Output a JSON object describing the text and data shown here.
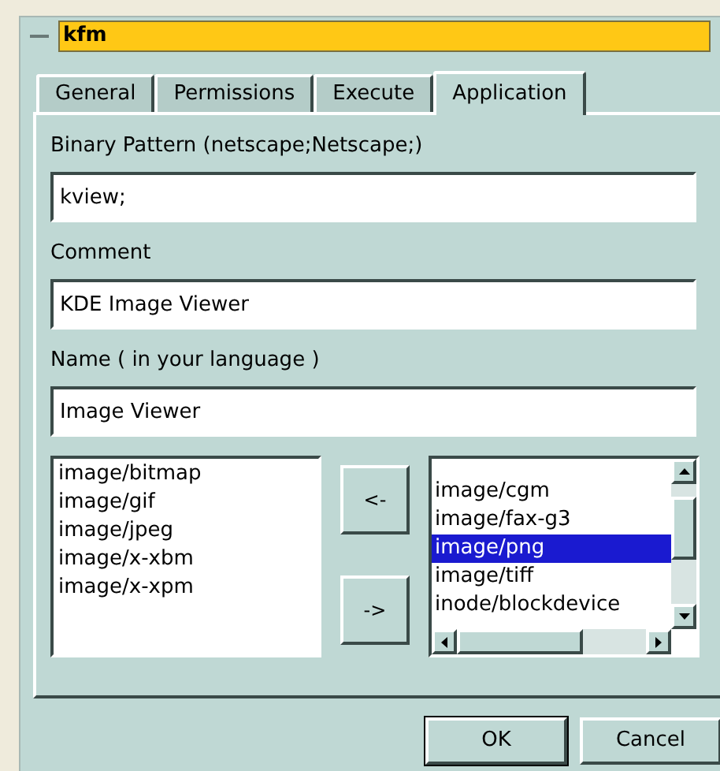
{
  "window": {
    "title": "kfm"
  },
  "tabs": [
    {
      "label": "General",
      "selected": false
    },
    {
      "label": "Permissions",
      "selected": false
    },
    {
      "label": "Execute",
      "selected": false
    },
    {
      "label": "Application",
      "selected": true
    }
  ],
  "fields": [
    {
      "label": "Binary Pattern (netscape;Netscape;)",
      "value": "kview;"
    },
    {
      "label": "Comment",
      "value": "KDE Image Viewer"
    },
    {
      "label": "Name ( in your language )",
      "value": "Image Viewer"
    }
  ],
  "selected_types": [
    {
      "label": "image/bitmap"
    },
    {
      "label": "image/gif"
    },
    {
      "label": "image/jpeg"
    },
    {
      "label": "image/x-xbm"
    },
    {
      "label": "image/x-xpm"
    }
  ],
  "move_buttons": [
    "<-",
    "->"
  ],
  "available_types": [
    {
      "label": "image/cgm",
      "selected": false
    },
    {
      "label": "image/fax-g3",
      "selected": false
    },
    {
      "label": "image/png",
      "selected": true
    },
    {
      "label": "image/tiff",
      "selected": false
    },
    {
      "label": "inode/blockdevice",
      "selected": false
    }
  ],
  "buttons": [
    "OK",
    "Cancel"
  ]
}
